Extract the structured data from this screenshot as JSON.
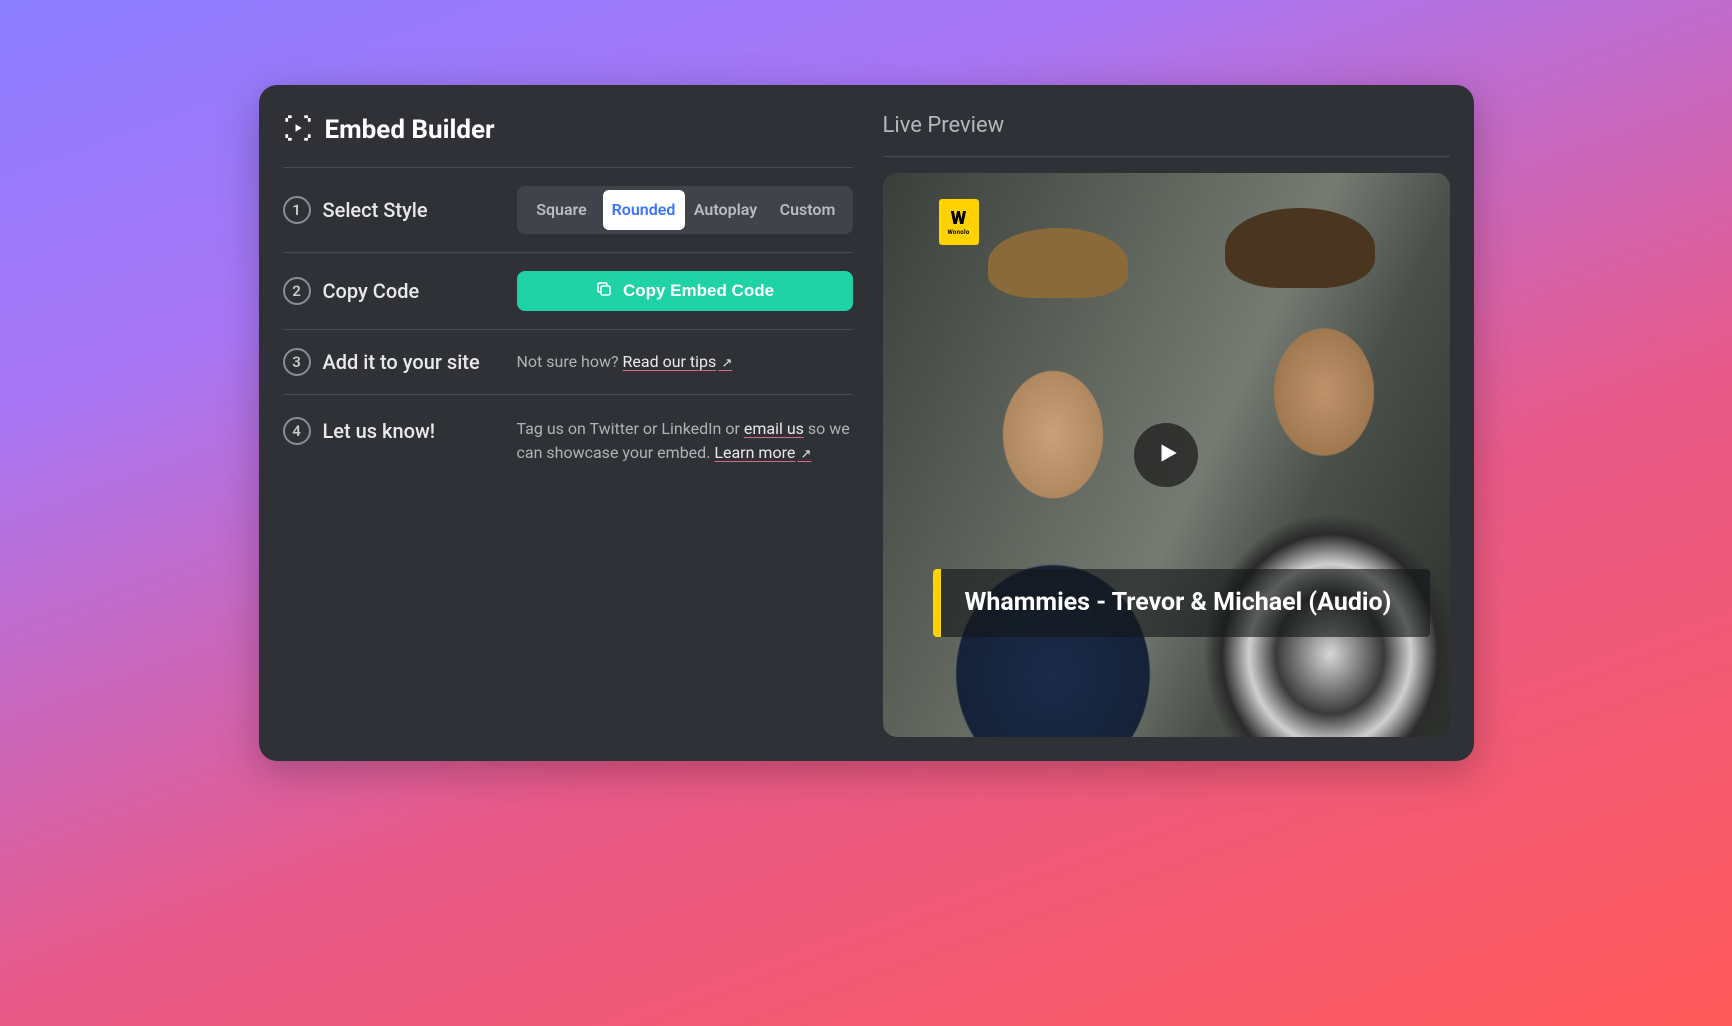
{
  "header": {
    "title": "Embed Builder"
  },
  "steps": {
    "s1": {
      "num": "1",
      "title": "Select Style"
    },
    "s2": {
      "num": "2",
      "title": "Copy Code"
    },
    "s3": {
      "num": "3",
      "title": "Add it to your site"
    },
    "s4": {
      "num": "4",
      "title": "Let us know!"
    }
  },
  "styleTabs": {
    "square": "Square",
    "rounded": "Rounded",
    "autoplay": "Autoplay",
    "custom": "Custom"
  },
  "copyButton": "Copy Embed Code",
  "step3": {
    "prefix": "Not sure how? ",
    "link": "Read our tips"
  },
  "step4": {
    "prefix": "Tag us on Twitter or LinkedIn or ",
    "emailLink": "email us",
    "middle": " so we can showcase your embed. ",
    "learnLink": "Learn more"
  },
  "preview": {
    "heading": "Live Preview",
    "brandTop": "W",
    "brandSub": "Wonolo",
    "videoTitle": "Whammies - Trevor & Michael (Audio)"
  }
}
